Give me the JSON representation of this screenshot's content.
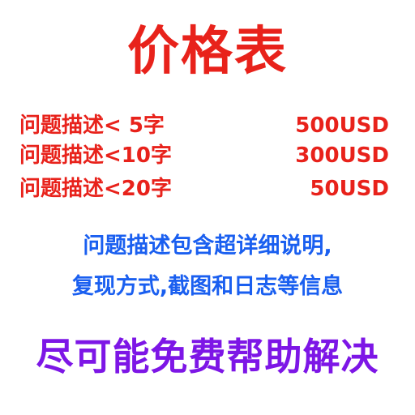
{
  "title": "价格表",
  "price_list": [
    {
      "description": "问题描述< 5字",
      "price": "500USD"
    },
    {
      "description": "问题描述<10字",
      "price": "300USD"
    },
    {
      "description": "问题描述<20字",
      "price": "50USD"
    }
  ],
  "note_lines": [
    "问题描述包含超详细说明,",
    "复现方式,截图和日志等信息"
  ],
  "banner": "尽可能免费帮助解决",
  "colors": {
    "title": "#e8221b",
    "price": "#e8221b",
    "note": "#1a5ff0",
    "banner": "#7d16e6",
    "background": "#ffffff"
  }
}
